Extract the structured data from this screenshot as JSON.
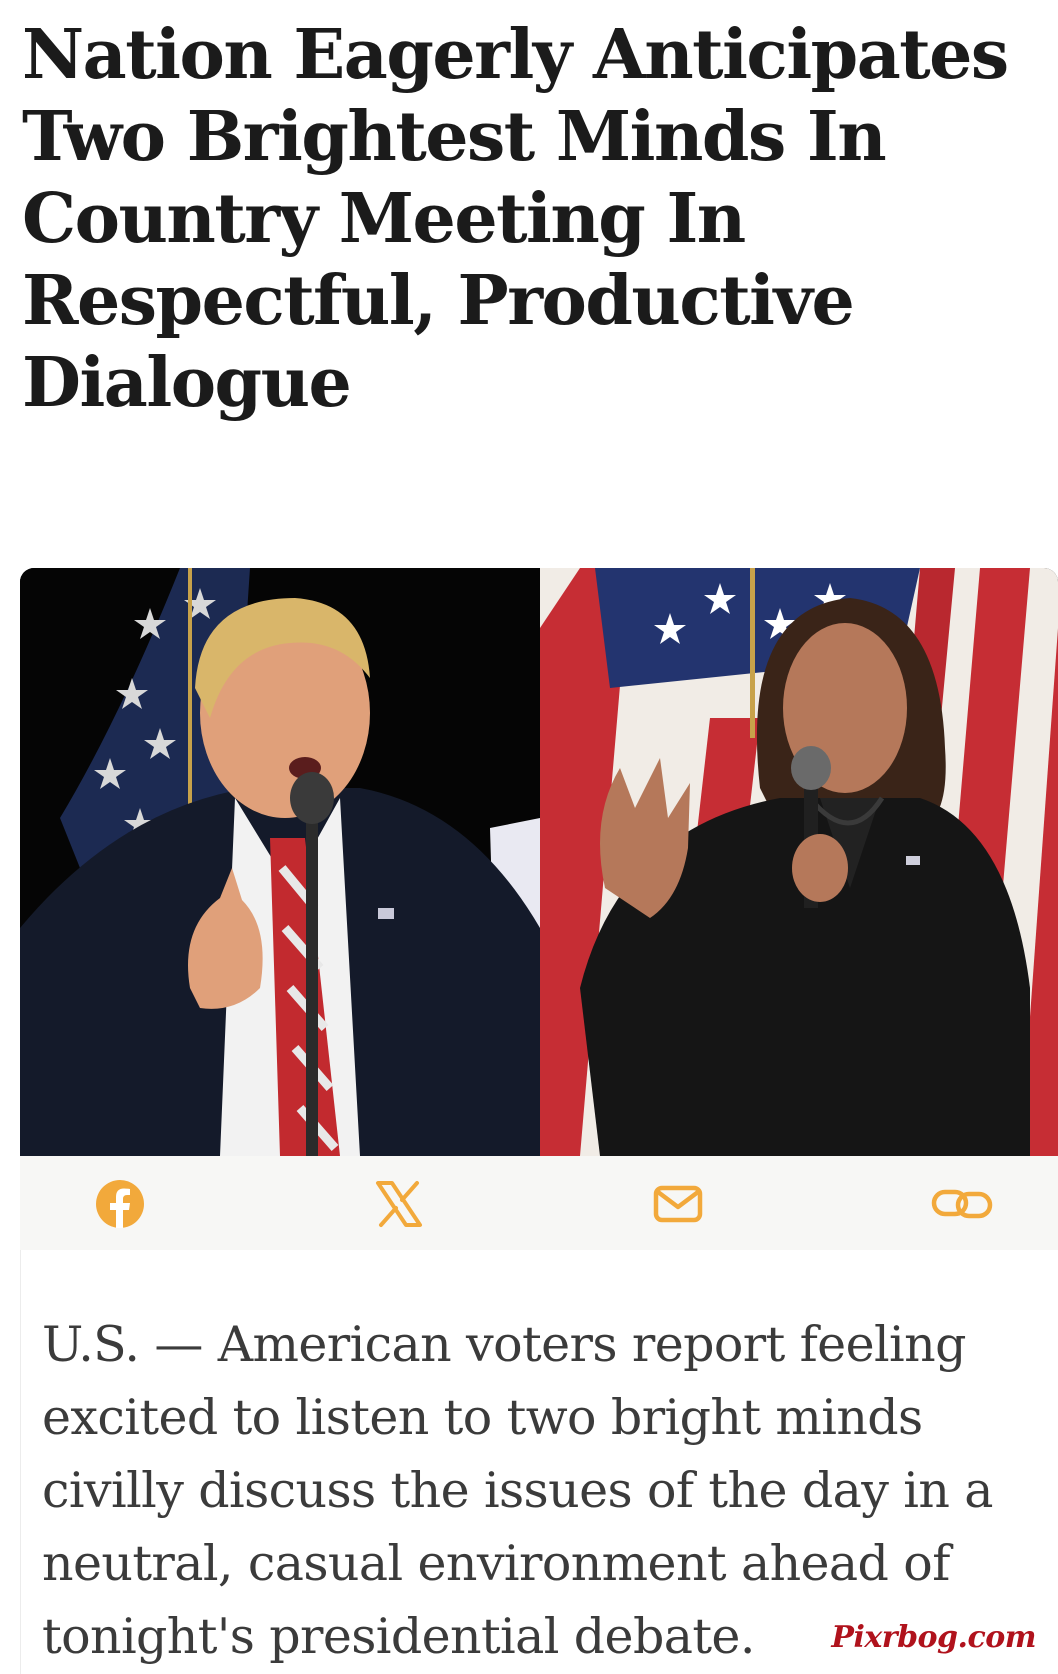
{
  "article": {
    "headline": "Nation Eagerly Anticipates Two Brightest Minds In Country Meeting In Respectful, Productive Dialogue",
    "body": "U.S. — American voters report feeling excited to listen to two bright minds civilly discuss the issues of the day in a neutral, casual environment ahead of tonight's presidential debate."
  },
  "share_bar": {
    "buttons": [
      {
        "name": "facebook",
        "icon": "facebook-icon"
      },
      {
        "name": "x",
        "icon": "x-icon"
      },
      {
        "name": "email",
        "icon": "mail-icon"
      },
      {
        "name": "link",
        "icon": "link-icon"
      }
    ],
    "icon_color": "#f2a93b"
  },
  "watermark": "Pixrbog.com",
  "colors": {
    "headline": "#1b1b1b",
    "body_text": "#3b3b3b",
    "share_bar_bg": "#f7f7f5",
    "watermark": "#b0121c"
  }
}
